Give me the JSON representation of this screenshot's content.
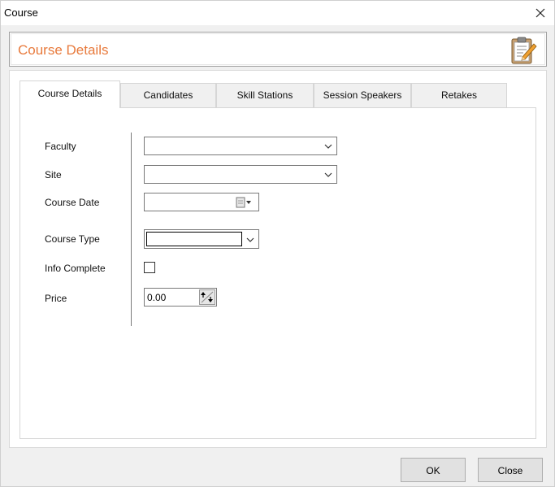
{
  "window": {
    "title": "Course"
  },
  "header": {
    "title": "Course Details",
    "icon": "clipboard-edit-icon"
  },
  "tabs": [
    {
      "label": "Course Details",
      "active": true
    },
    {
      "label": "Candidates",
      "active": false
    },
    {
      "label": "Skill Stations",
      "active": false
    },
    {
      "label": "Session Speakers",
      "active": false
    },
    {
      "label": "Retakes",
      "active": false
    }
  ],
  "form": {
    "faculty": {
      "label": "Faculty",
      "value": ""
    },
    "site": {
      "label": "Site",
      "value": ""
    },
    "course_date": {
      "label": "Course Date",
      "value": ""
    },
    "course_type": {
      "label": "Course Type",
      "value": ""
    },
    "info_complete": {
      "label": "Info Complete",
      "checked": false
    },
    "price": {
      "label": "Price",
      "value": "0.00"
    }
  },
  "buttons": {
    "ok": "OK",
    "close": "Close"
  },
  "colors": {
    "header_title": "#e87a3c",
    "accent_pencil": "#f0a030"
  }
}
